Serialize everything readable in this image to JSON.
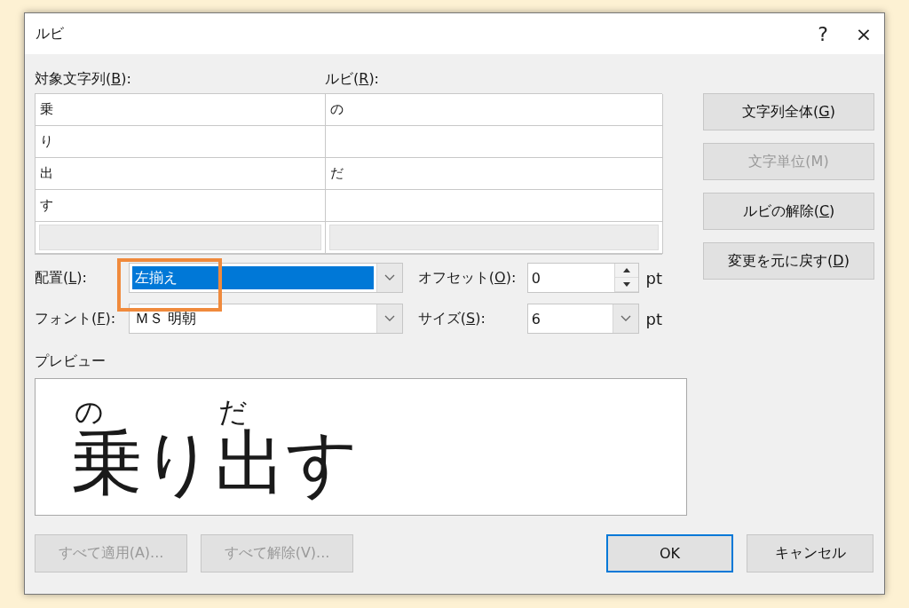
{
  "window": {
    "title": "ルビ",
    "help": "?",
    "close": "×"
  },
  "table": {
    "columns": [
      {
        "pre": "対象文字列(",
        "key": "B",
        "post": "):"
      },
      {
        "pre": "ルビ(",
        "key": "R",
        "post": "):"
      }
    ],
    "rows": [
      {
        "base": "乗",
        "ruby": "の",
        "disabled": false
      },
      {
        "base": "り",
        "disabled": false
      },
      {
        "base": "出",
        "ruby": "だ",
        "disabled": false
      },
      {
        "base": "す",
        "disabled": false
      },
      {
        "disabled": true
      }
    ]
  },
  "side_buttons": [
    {
      "pre": "文字列全体(",
      "key": "G",
      "post": ")",
      "disabled": false
    },
    {
      "pre": "文字単位(M)",
      "disabled": true
    },
    {
      "pre": "ルビの解除(",
      "key": "C",
      "post": ")",
      "disabled": false
    },
    {
      "pre": "変更を元に戻す(",
      "key": "D",
      "post": ")",
      "disabled": false
    }
  ],
  "alignment": {
    "label": {
      "pre": "配置(",
      "key": "L",
      "post": "):"
    },
    "value": "左揃え",
    "selected": true
  },
  "font": {
    "label": {
      "pre": "フォント(",
      "key": "F",
      "post": "):"
    },
    "value": "ＭＳ 明朝",
    "selected": false
  },
  "offset": {
    "label": {
      "pre": "オフセット(",
      "key": "O",
      "post": "):"
    },
    "value": "0",
    "unit": "pt"
  },
  "size": {
    "label": {
      "pre": "サイズ(",
      "key": "S",
      "post": "):"
    },
    "value": "6",
    "unit": "pt"
  },
  "preview": {
    "label": "プレビュー",
    "items": [
      {
        "base": "乗",
        "ruby": "の"
      },
      {
        "base": "り"
      },
      {
        "base": "出",
        "ruby": "だ"
      },
      {
        "base": "す"
      }
    ]
  },
  "footer_buttons": [
    {
      "label": "すべて適用(A)...",
      "disabled": true,
      "default": false
    },
    {
      "label": "すべて解除(V)...",
      "disabled": true,
      "default": false
    },
    {
      "label": "OK",
      "disabled": false,
      "default": true
    },
    {
      "label": "キャンセル",
      "disabled": false,
      "default": false
    }
  ]
}
